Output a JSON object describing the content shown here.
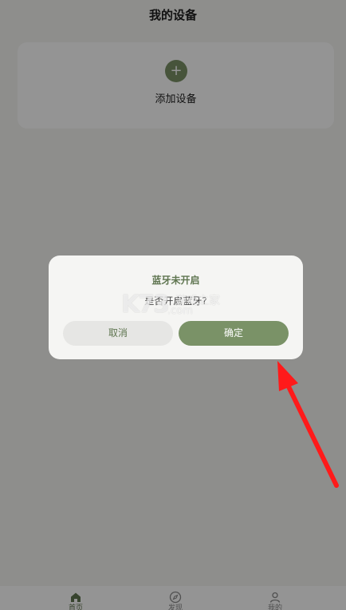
{
  "header": {
    "title": "我的设备"
  },
  "add_device": {
    "icon": "plus-icon",
    "glyph": "+",
    "label": "添加设备"
  },
  "tabbar": {
    "items": [
      {
        "label": "首页",
        "icon": "home-icon",
        "active": true
      },
      {
        "label": "发现",
        "icon": "compass-icon",
        "active": false
      },
      {
        "label": "我的",
        "icon": "user-icon",
        "active": false
      }
    ]
  },
  "dialog": {
    "title": "蓝牙未开启",
    "message": "是否开启蓝牙?",
    "cancel_label": "取消",
    "confirm_label": "确定"
  },
  "watermark": {
    "logo": "K73",
    "name": "游戏之家",
    "domain": ".com"
  },
  "colors": {
    "accent": "#7a9267",
    "accent_text": "#5f7550",
    "annotation_arrow": "#ff1a1a"
  }
}
